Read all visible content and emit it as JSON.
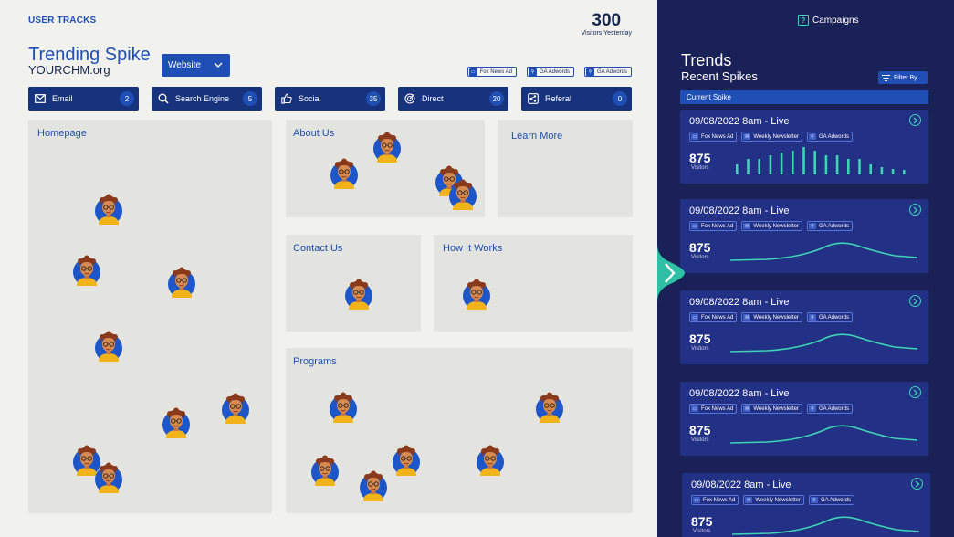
{
  "header": {
    "section_label": "USER TRACKS",
    "visitors_yesterday": "300",
    "visitors_yesterday_label": "Visitors Yesterday",
    "title": "Trending Spike",
    "subtitle": "YOURCHM.org",
    "select_value": "Website"
  },
  "source_tags": [
    {
      "label": "Fox News Ad",
      "icon": "tv-icon"
    },
    {
      "label": "GA Adwords",
      "icon": "search-icon"
    },
    {
      "label": "GA Adwords",
      "icon": "search-icon"
    }
  ],
  "channels": [
    {
      "label": "Email",
      "count": "2",
      "icon": "mail-icon"
    },
    {
      "label": "Search Engine",
      "count": "5",
      "icon": "search-icon"
    },
    {
      "label": "Social",
      "count": "35",
      "icon": "thumbs-up-icon"
    },
    {
      "label": "Direct",
      "count": "20",
      "icon": "target-icon"
    },
    {
      "label": "Referal",
      "count": "0",
      "icon": "share-icon"
    }
  ],
  "panels": {
    "homepage": "Homepage",
    "about": "About Us",
    "learn": "Learn More",
    "contact": "Contact Us",
    "how": "How It Works",
    "programs": "Programs"
  },
  "sidebar": {
    "campaigns_label": "Campaigns",
    "trends_title": "Trends",
    "trends_subtitle": "Recent Spikes",
    "filter_label": "Filter By",
    "current_spike_label": "Current Spike",
    "cards": [
      {
        "time": "09/08/2022 8am - Live",
        "visitors": "875",
        "visitors_label": "Visitors",
        "type": "bar"
      },
      {
        "time": "09/08/2022 8am - Live",
        "visitors": "875",
        "visitors_label": "Visitors",
        "type": "curve"
      },
      {
        "time": "09/08/2022 8am - Live",
        "visitors": "875",
        "visitors_label": "Visitors",
        "type": "curve"
      },
      {
        "time": "09/08/2022 8am - Live",
        "visitors": "875",
        "visitors_label": "Visitors",
        "type": "curve"
      },
      {
        "time": "09/08/2022 8am - Live",
        "visitors": "875",
        "visitors_label": "Visitors",
        "type": "curve"
      }
    ],
    "card_tags": [
      {
        "label": "Fox News Ad",
        "icon": "tv-icon"
      },
      {
        "label": "Weekly Newsletter",
        "icon": "mail-icon"
      },
      {
        "label": "GA Adwords",
        "icon": "search-icon"
      }
    ],
    "spike_bars": [
      0.35,
      0.55,
      0.55,
      0.7,
      0.8,
      0.85,
      1.0,
      0.85,
      0.7,
      0.7,
      0.55,
      0.55,
      0.35,
      0.25,
      0.2,
      0.15
    ],
    "accent_color": "#3fd4b6"
  }
}
